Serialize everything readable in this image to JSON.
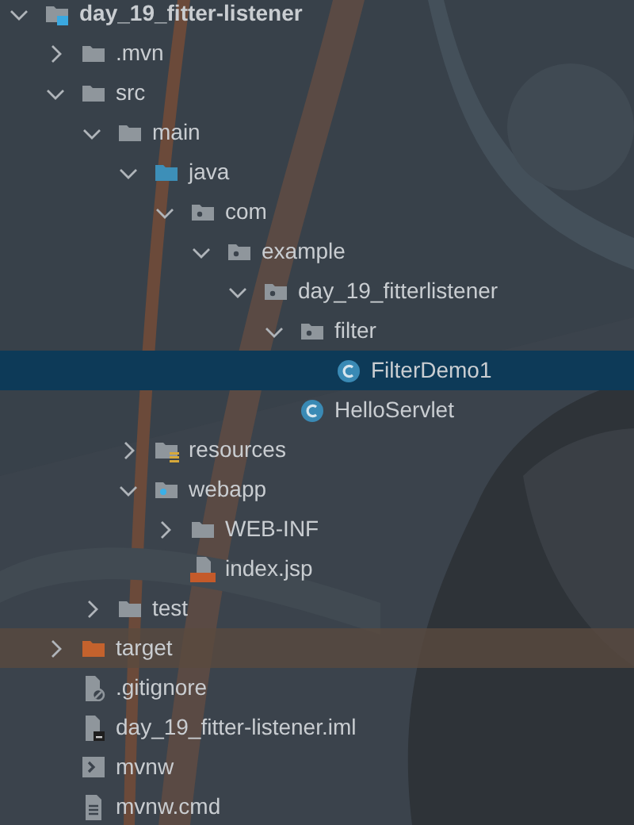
{
  "project_tree": [
    {
      "label": "day_19_fitter-listener",
      "kind": "module",
      "expanded": true,
      "selected": false,
      "children": [
        {
          "label": ".mvn",
          "kind": "folder",
          "expanded": false,
          "selected": false
        },
        {
          "label": "src",
          "kind": "folder",
          "expanded": true,
          "selected": false,
          "children": [
            {
              "label": "main",
              "kind": "folder",
              "expanded": true,
              "selected": false,
              "children": [
                {
                  "label": "java",
                  "kind": "source-folder",
                  "expanded": true,
                  "selected": false,
                  "children": [
                    {
                      "label": "com",
                      "kind": "package",
                      "expanded": true,
                      "selected": false,
                      "children": [
                        {
                          "label": "example",
                          "kind": "package",
                          "expanded": true,
                          "selected": false,
                          "children": [
                            {
                              "label": "day_19_fitterlistener",
                              "kind": "package",
                              "expanded": true,
                              "selected": false,
                              "children": [
                                {
                                  "label": "filter",
                                  "kind": "package",
                                  "expanded": true,
                                  "selected": false,
                                  "children": [
                                    {
                                      "label": "FilterDemo1",
                                      "kind": "class",
                                      "selected": true
                                    }
                                  ]
                                },
                                {
                                  "label": "HelloServlet",
                                  "kind": "class",
                                  "selected": false
                                }
                              ]
                            }
                          ]
                        }
                      ]
                    }
                  ]
                },
                {
                  "label": "resources",
                  "kind": "resource-folder",
                  "expanded": false,
                  "selected": false
                },
                {
                  "label": "webapp",
                  "kind": "web-folder",
                  "expanded": true,
                  "selected": false,
                  "children": [
                    {
                      "label": "WEB-INF",
                      "kind": "folder",
                      "expanded": false,
                      "selected": false
                    },
                    {
                      "label": "index.jsp",
                      "kind": "jsp",
                      "selected": false
                    }
                  ]
                }
              ]
            },
            {
              "label": "test",
              "kind": "folder",
              "expanded": false,
              "selected": false
            }
          ]
        },
        {
          "label": "target",
          "kind": "excluded-folder",
          "expanded": false,
          "selected": false
        },
        {
          "label": ".gitignore",
          "kind": "gitignore",
          "selected": false
        },
        {
          "label": "day_19_fitter-listener.iml",
          "kind": "iml",
          "selected": false
        },
        {
          "label": "mvnw",
          "kind": "shell",
          "selected": false
        },
        {
          "label": "mvnw.cmd",
          "kind": "text",
          "selected": false
        }
      ]
    }
  ]
}
